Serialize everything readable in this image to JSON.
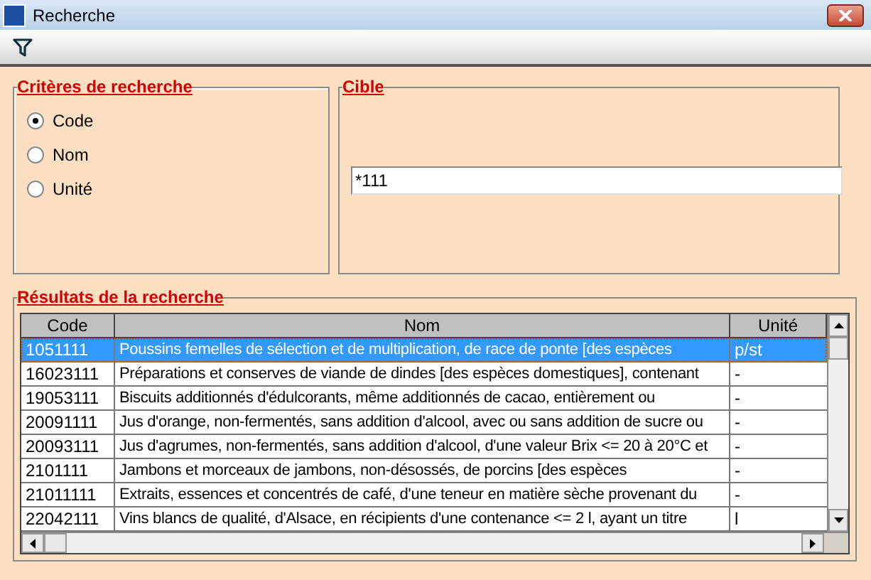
{
  "window": {
    "title": "Recherche"
  },
  "criteria": {
    "title": "Critères de recherche",
    "options": [
      {
        "label": "Code",
        "selected": true
      },
      {
        "label": "Nom",
        "selected": false
      },
      {
        "label": "Unité",
        "selected": false
      }
    ]
  },
  "target": {
    "title": "Cible",
    "value": "*111"
  },
  "results": {
    "title": "Résultats de la recherche",
    "columns": [
      "Code",
      "Nom",
      "Unité"
    ],
    "rows": [
      {
        "code": "1051111",
        "nom": "Poussins femelles de sélection et de multiplication, de race de ponte [des espèces",
        "unite": "p/st",
        "selected": true
      },
      {
        "code": "16023111",
        "nom": "Préparations et conserves de viande de dindes [des espèces domestiques], contenant",
        "unite": "-",
        "selected": false
      },
      {
        "code": "19053111",
        "nom": "Biscuits additionnés d'édulcorants, même additionnés de cacao, entièrement ou",
        "unite": "-",
        "selected": false
      },
      {
        "code": "20091111",
        "nom": "Jus d'orange, non-fermentés, sans addition d'alcool, avec ou sans addition de sucre ou",
        "unite": "-",
        "selected": false
      },
      {
        "code": "20093111",
        "nom": "Jus d'agrumes, non-fermentés, sans addition d'alcool, d'une valeur Brix <= 20 à 20°C et",
        "unite": "-",
        "selected": false
      },
      {
        "code": "2101111",
        "nom": "Jambons et morceaux de jambons, non-désossés, de porcins [des espèces",
        "unite": "-",
        "selected": false
      },
      {
        "code": "21011111",
        "nom": "Extraits, essences et concentrés de café, d'une teneur en matière sèche provenant du",
        "unite": "-",
        "selected": false
      },
      {
        "code": "22042111",
        "nom": "Vins blancs de qualité, d'Alsace, en récipients d'une contenance <= 2 l, ayant un titre",
        "unite": "l",
        "selected": false
      }
    ]
  }
}
